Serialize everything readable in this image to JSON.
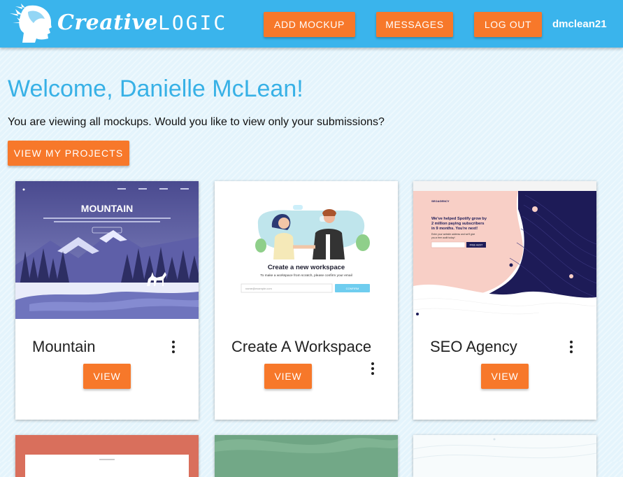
{
  "navbar": {
    "logo_word_1": "Creative",
    "logo_word_2": "LOGIC",
    "add_mockup_label": "ADD MOCKUP",
    "messages_label": "MESSAGES",
    "logout_label": "LOG OUT",
    "username": "dmclean21",
    "colors": {
      "bar": "#3ab4ec",
      "button": "#f7782a"
    }
  },
  "main": {
    "welcome": "Welcome, Danielle McLean!",
    "subtitle": "You are viewing all mockups. Would you like to view only your submissions?",
    "view_projects_label": "VIEW MY PROJECTS"
  },
  "cards": [
    {
      "title": "Mountain",
      "button_label": "VIEW",
      "thumb": {
        "headline": "MOUNTAIN"
      }
    },
    {
      "title": "Create A Workspace",
      "button_label": "VIEW",
      "thumb": {
        "headline": "Create a new workspace",
        "subline": "To make a workspace from scratch, please confirm your email",
        "input_placeholder": "name@example.com",
        "button": "CONFIRM"
      }
    },
    {
      "title": "SEO Agency",
      "button_label": "VIEW",
      "thumb": {
        "brand": "SEOAGENCY",
        "headline_1": "We've helped Spotify grow by",
        "headline_2": "2 million paying subscribers",
        "headline_3": "in 9 months. You're next!",
        "subline_1": "Enter your website address and we'll give",
        "subline_2": "you a free audit today!",
        "button": "FREE AUDIT"
      }
    }
  ],
  "icons": {
    "logo": "head-profile-with-birds-icon",
    "card_menu": "more-vertical-icon"
  }
}
